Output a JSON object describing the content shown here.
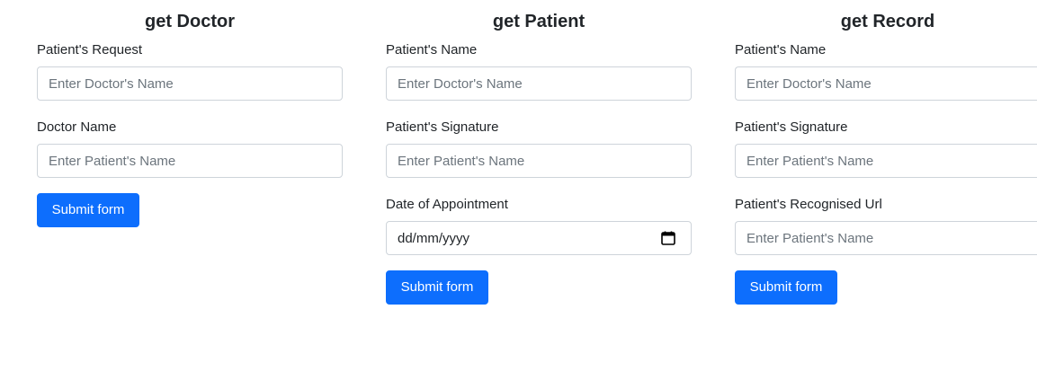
{
  "doctor_form": {
    "title": "get Doctor",
    "fields": [
      {
        "label": "Patient's Request",
        "placeholder": "Enter Doctor's Name",
        "value": ""
      },
      {
        "label": "Doctor Name",
        "placeholder": "Enter Patient's Name",
        "value": ""
      }
    ],
    "submit_label": "Submit form"
  },
  "patient_form": {
    "title": "get Patient",
    "fields": [
      {
        "label": "Patient's Name",
        "placeholder": "Enter Doctor's Name",
        "value": ""
      },
      {
        "label": "Patient's Signature",
        "placeholder": "Enter Patient's Name",
        "value": ""
      }
    ],
    "date_field": {
      "label": "Date of Appointment",
      "placeholder": "dd/mm/yyyy",
      "icon": "calendar-icon"
    },
    "submit_label": "Submit form"
  },
  "record_form": {
    "title": "get Record",
    "fields": [
      {
        "label": "Patient's Name",
        "placeholder": "Enter Doctor's Name",
        "value": ""
      },
      {
        "label": "Patient's Signature",
        "placeholder": "Enter Patient's Name",
        "value": ""
      },
      {
        "label": "Patient's Recognised Url",
        "placeholder": "Enter Patient's Name",
        "value": ""
      }
    ],
    "submit_label": "Submit form"
  },
  "colors": {
    "primary": "#0d6efd",
    "border": "#ced4da",
    "placeholder": "#6c757d",
    "text": "#212529"
  }
}
